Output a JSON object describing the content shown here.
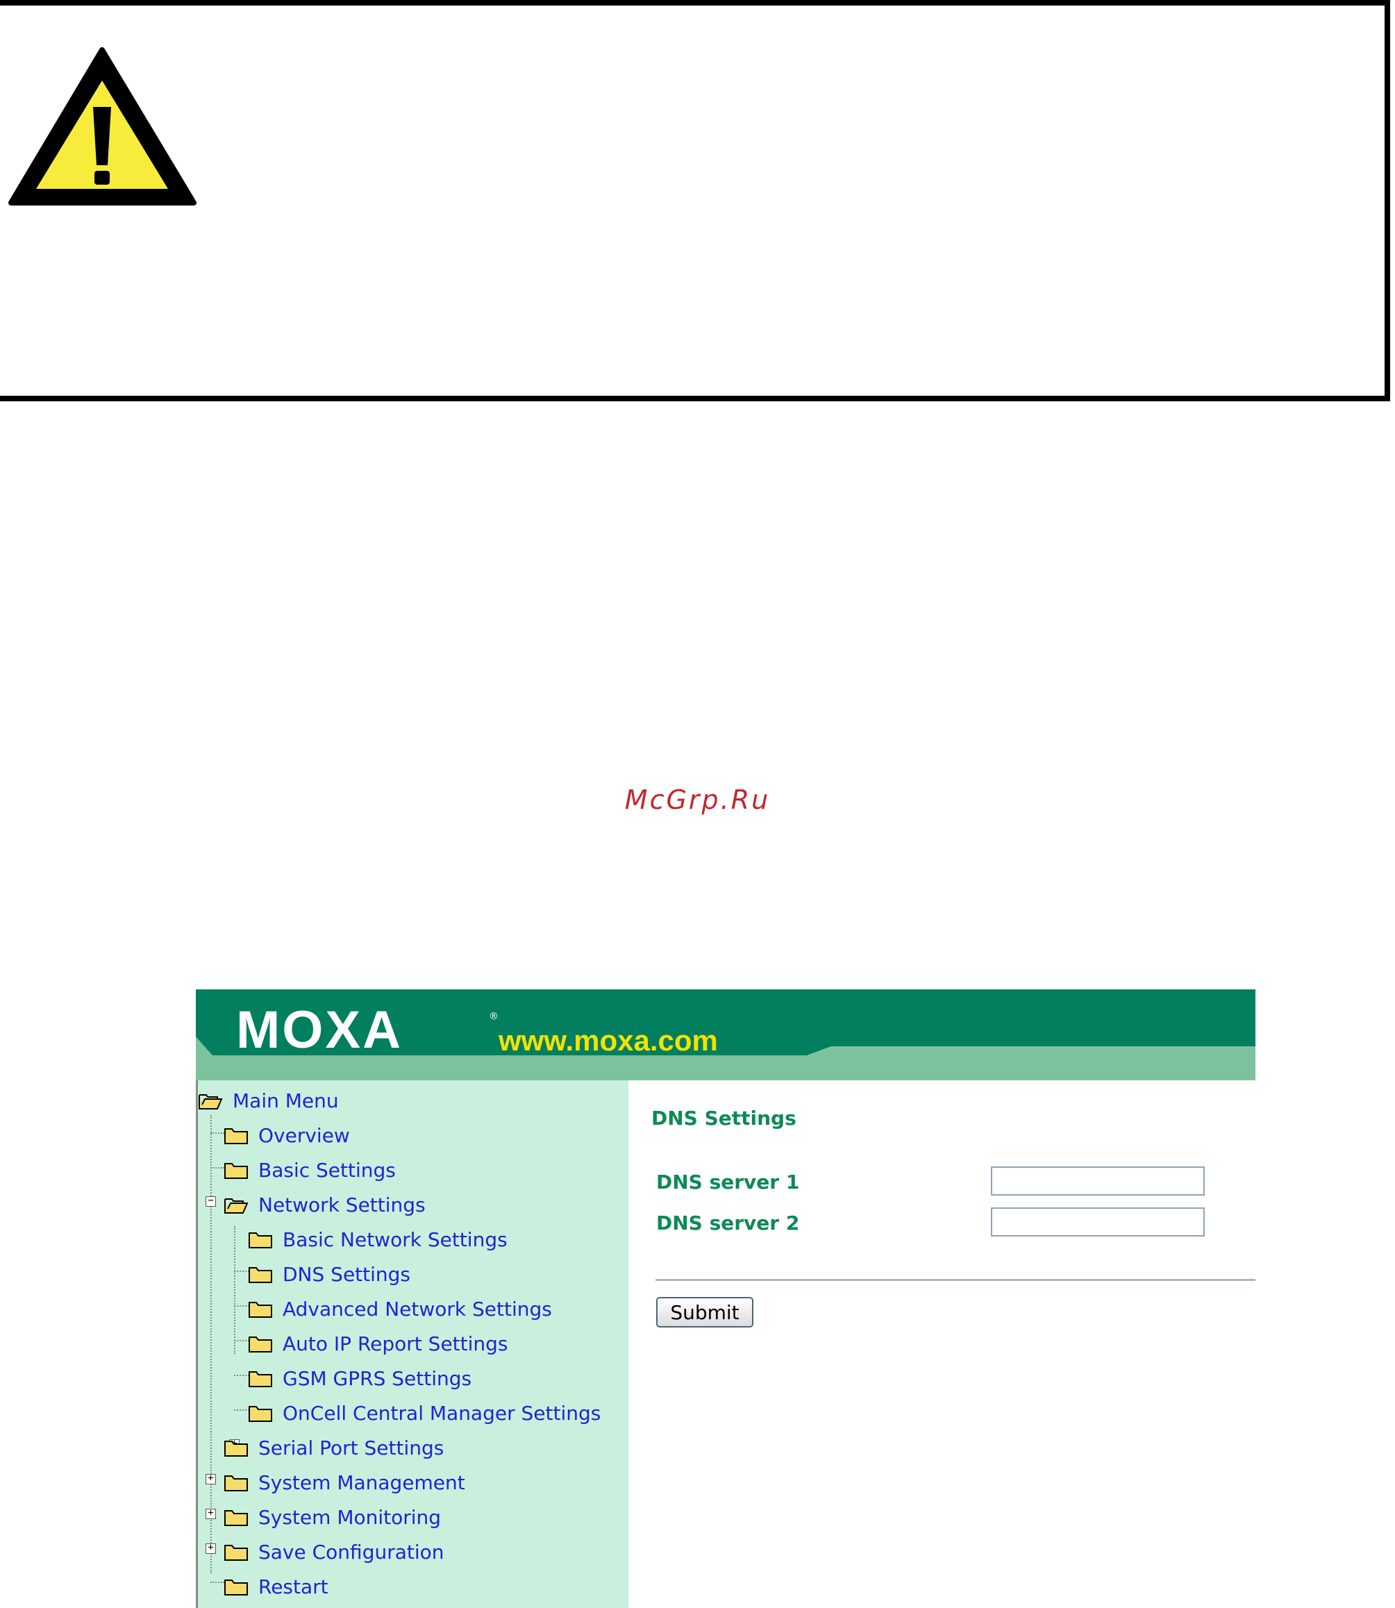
{
  "watermark": "McGrp.Ru",
  "moxa": {
    "logo_text": "MOXA",
    "website": "www.moxa.com",
    "colors": {
      "banner_dark": "#017F5E",
      "banner_light": "#7CC39D",
      "sidebar_bg": "#C9F0DC",
      "link": "#1D23D6",
      "label_green": "#0D8A55"
    }
  },
  "sidebar": {
    "root_label": "Main Menu",
    "items": [
      {
        "label": "Overview"
      },
      {
        "label": "Basic Settings"
      },
      {
        "label": "Network Settings"
      },
      {
        "label": "Basic Network Settings"
      },
      {
        "label": "DNS Settings"
      },
      {
        "label": "Advanced Network Settings"
      },
      {
        "label": "Auto IP Report Settings"
      },
      {
        "label": "GSM GPRS Settings"
      },
      {
        "label": "OnCell Central Manager Settings"
      },
      {
        "label": "Serial Port Settings"
      },
      {
        "label": "System Management"
      },
      {
        "label": "System Monitoring"
      },
      {
        "label": "Save Configuration"
      },
      {
        "label": "Restart"
      }
    ]
  },
  "content": {
    "title": "DNS Settings",
    "fields": [
      {
        "label": "DNS server 1",
        "value": ""
      },
      {
        "label": "DNS server 2",
        "value": ""
      }
    ],
    "submit_label": "Submit"
  }
}
